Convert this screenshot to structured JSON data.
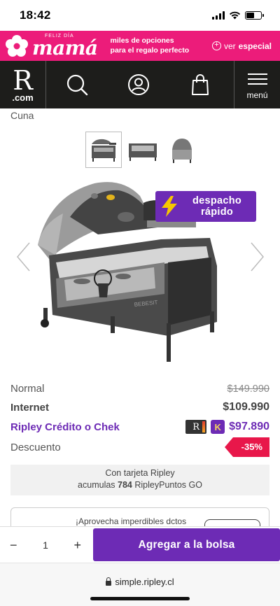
{
  "status_bar": {
    "time": "18:42"
  },
  "promo_banner": {
    "small_text": "feliz día",
    "brand": "mamá",
    "copy_line1": "miles de opciones",
    "copy_line2": "para el regalo perfecto",
    "cta_prefix": "ver",
    "cta_bold": "especial",
    "bg_color": "#ec1c7a"
  },
  "header": {
    "logo_letter": "R",
    "logo_suffix": ".com",
    "menu_label": "menú",
    "bg_color": "#1d1d1b"
  },
  "breadcrumb": "Cuna",
  "gallery": {
    "thumbnails": [
      "thumb-1",
      "thumb-2",
      "thumb-3"
    ],
    "active_index": 0
  },
  "badge": {
    "line1": "despacho",
    "line2": "rápido",
    "color": "#6d2bb5"
  },
  "prices": {
    "normal_label": "Normal",
    "normal_value": "$149.990",
    "internet_label": "Internet",
    "internet_value": "$109.990",
    "credit_label": "Ripley Crédito o Chek",
    "credit_card_r": "R",
    "credit_card_k": "K",
    "credit_value": "$97.890",
    "discount_label": "Descuento",
    "discount_value": "-35%"
  },
  "points": {
    "line1": "Con tarjeta Ripley",
    "prefix": "acumulas",
    "amount": "784",
    "suffix": "RipleyPuntos GO"
  },
  "promo_box": {
    "text": "¡Aprovecha imperdibles dctos"
  },
  "purchase": {
    "minus": "−",
    "quantity": "1",
    "plus": "+",
    "add_label": "Agregar a la bolsa"
  },
  "browser": {
    "url": "simple.ripley.cl"
  }
}
